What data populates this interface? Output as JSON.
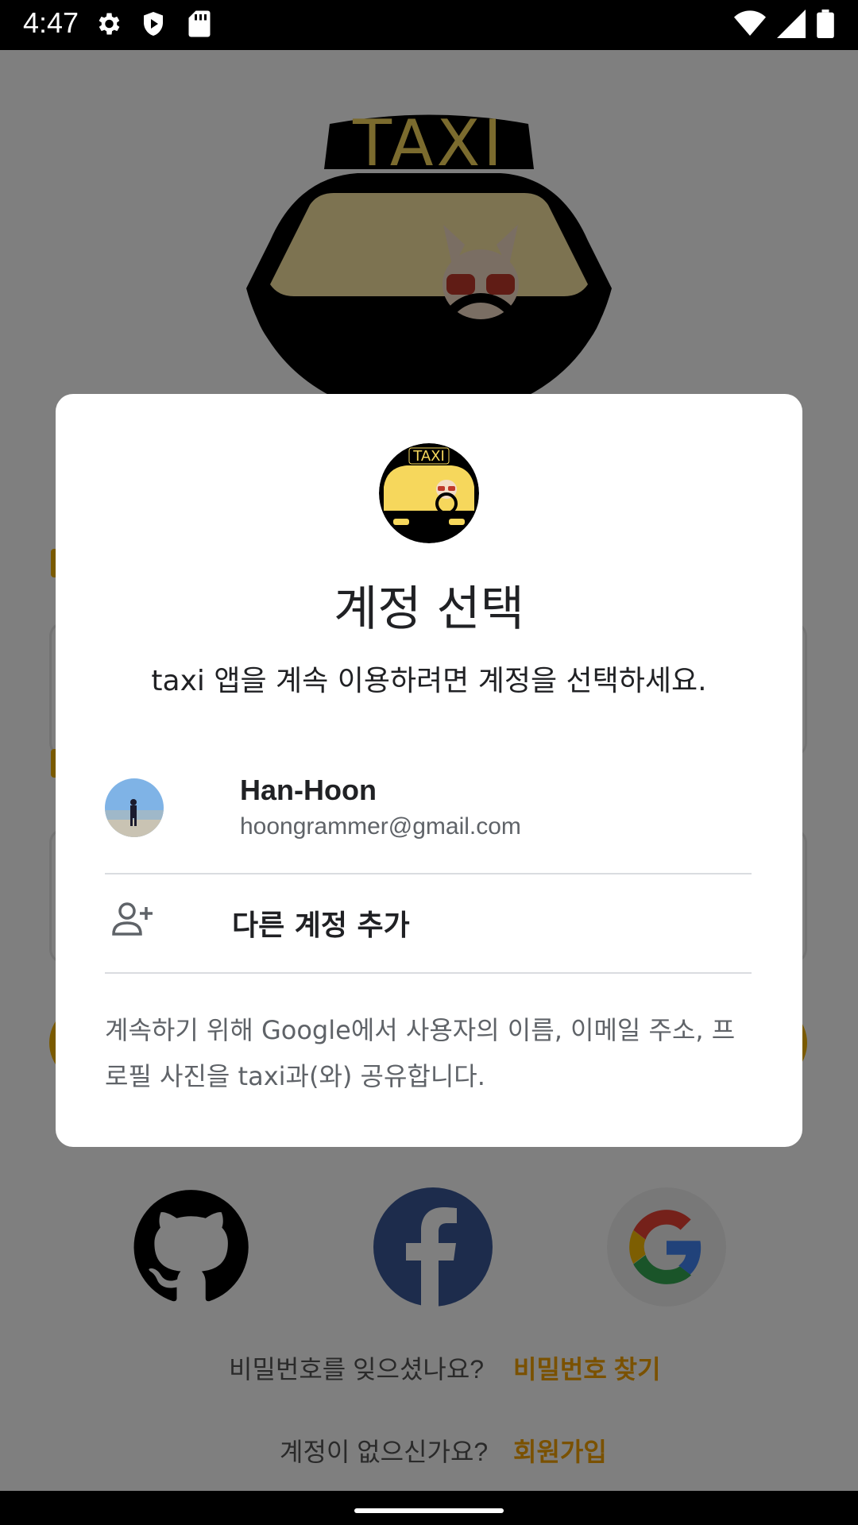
{
  "status_bar": {
    "time": "4:47",
    "icons_left": [
      "gear-icon",
      "play-protect-icon",
      "sd-card-icon"
    ],
    "icons_right": [
      "wifi-icon",
      "signal-icon",
      "battery-icon"
    ]
  },
  "background_app": {
    "logo_text": "TAXI",
    "forgot_password_prompt": "비밀번호를 잊으셨나요?",
    "forgot_password_link": "비밀번호 찾기",
    "no_account_prompt": "계정이 없으신가요?",
    "signup_link": "회원가입",
    "social_buttons": [
      "github-icon",
      "facebook-icon",
      "google-icon"
    ],
    "accent_color": "#f4b400"
  },
  "dialog": {
    "logo_text": "TAXI",
    "title": "계정 선택",
    "subtitle": "taxi 앱을 계속 이용하려면 계정을 선택하세요.",
    "account": {
      "name": "Han-Hoon",
      "email": "hoongrammer@gmail.com"
    },
    "add_account_label": "다른 계정 추가",
    "note": "계속하기 위해 Google에서 사용자의 이름, 이메일 주소, 프로필 사진을 taxi과(와) 공유합니다."
  }
}
